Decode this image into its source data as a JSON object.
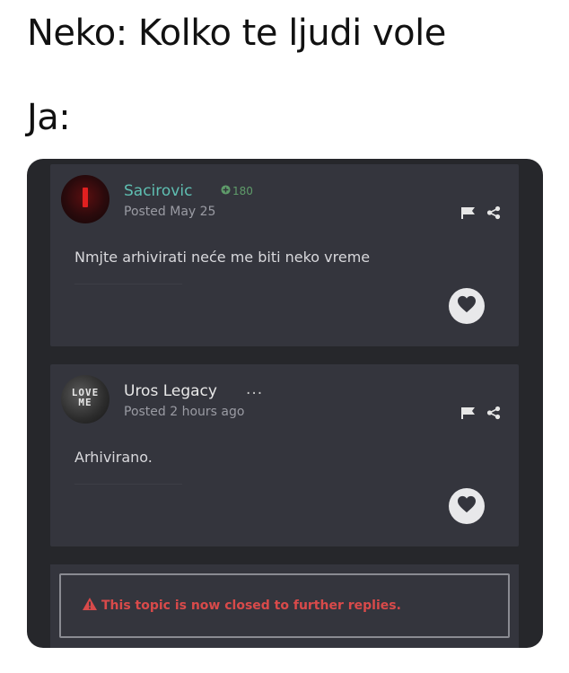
{
  "meme": {
    "line1": "Neko: Kolko te ljudi vole",
    "line2": "Ja:"
  },
  "posts": [
    {
      "author": "Sacirovic",
      "reputation": "180",
      "reputation_icon": "plus-circle-icon",
      "posted": "Posted May 25",
      "body": "Nmjte arhivirati neće me biti neko vreme",
      "avatar": "dark-red-avatar",
      "accent": "#5fbfb2"
    },
    {
      "author": "Uros Legacy",
      "more": "...",
      "posted": "Posted 2 hours ago",
      "body": "Arhivirano.",
      "avatar": "love-me-avatar",
      "avatar_text": "LOVE ME"
    }
  ],
  "closed_notice": {
    "text": "This topic is now closed to further replies.",
    "icon": "warning-icon",
    "color": "#d94a4a"
  },
  "icons": {
    "flag": "flag-icon",
    "share": "share-icon",
    "like": "heart-icon"
  },
  "colors": {
    "panel_bg": "#26272b",
    "card_bg": "#34353d",
    "author_accent": "#5fbfb2",
    "rep_green": "#5f9c6a"
  }
}
